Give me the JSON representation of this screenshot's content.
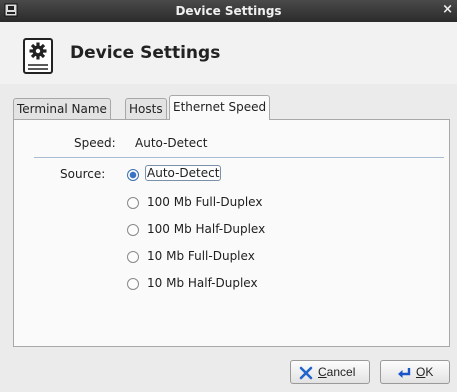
{
  "window": {
    "title": "Device Settings",
    "close_glyph": "×"
  },
  "header": {
    "title": "Device Settings",
    "icon": "gear-document-icon"
  },
  "tabs": [
    {
      "label": "Terminal Name",
      "active": false
    },
    {
      "label": "Hosts",
      "active": false
    },
    {
      "label": "Ethernet Speed",
      "active": true
    }
  ],
  "panel": {
    "speed_label": "Speed:",
    "speed_value": "Auto-Detect",
    "source_label": "Source:",
    "options": [
      {
        "label": "Auto-Detect",
        "selected": true
      },
      {
        "label": "100 Mb Full-Duplex",
        "selected": false
      },
      {
        "label": "100 Mb Half-Duplex",
        "selected": false
      },
      {
        "label": "10 Mb Full-Duplex",
        "selected": false
      },
      {
        "label": "10 Mb Half-Duplex",
        "selected": false
      }
    ]
  },
  "buttons": {
    "cancel": {
      "mnemonic": "C",
      "rest": "ancel"
    },
    "ok": {
      "mnemonic": "O",
      "rest": "K"
    }
  },
  "colors": {
    "accent": "#3a72c4",
    "titlebar": "#333333",
    "ok_arrow": "#1a56c8",
    "cancel_x": "#2266cc"
  }
}
